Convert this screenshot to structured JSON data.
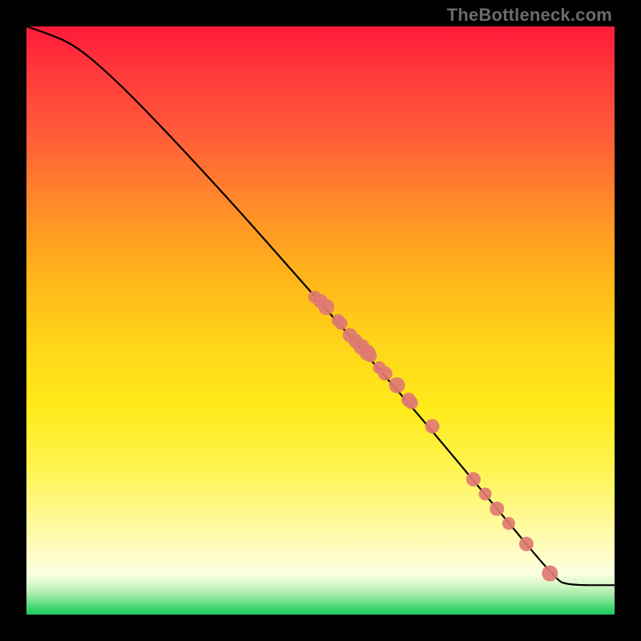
{
  "watermark": "TheBottleneck.com",
  "colors": {
    "marker": "#e07a72",
    "curve": "#000000"
  },
  "chart_data": {
    "type": "line",
    "title": "",
    "xlabel": "",
    "ylabel": "",
    "xlim": [
      0,
      100
    ],
    "ylim": [
      0,
      100
    ],
    "grid": false,
    "curve": {
      "x": [
        0,
        3,
        8,
        14,
        22,
        35,
        50,
        65,
        80,
        90,
        92,
        100
      ],
      "y": [
        100,
        99,
        97,
        92,
        84,
        70,
        53,
        36,
        18,
        6,
        5,
        5
      ]
    },
    "series": [
      {
        "name": "points",
        "type": "scatter",
        "x": [
          49,
          50,
          51,
          53,
          53.5,
          55,
          56,
          57,
          58,
          58.5,
          60,
          61,
          63,
          65,
          65.5,
          69,
          76,
          78,
          80,
          82,
          85,
          89
        ],
        "y": [
          54,
          53.3,
          52.3,
          50,
          49.5,
          47.5,
          46.5,
          45.5,
          44.5,
          44,
          42,
          41,
          39,
          36.5,
          36,
          32,
          23,
          20.5,
          18,
          15.5,
          12,
          7
        ],
        "r": [
          8,
          9,
          10,
          8,
          8,
          9,
          9,
          10,
          10,
          8,
          8,
          9,
          10,
          9,
          8,
          9,
          9,
          8,
          9,
          8,
          9,
          10
        ]
      }
    ]
  }
}
